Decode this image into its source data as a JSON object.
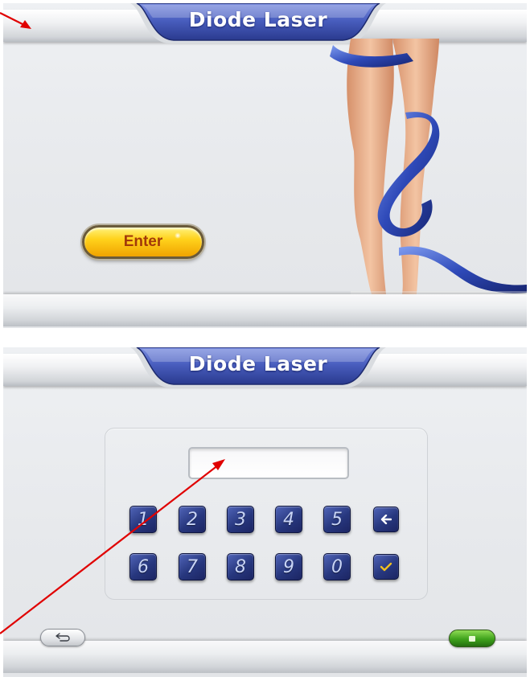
{
  "screen1": {
    "title": "Diode Laser",
    "enter_label": "Enter"
  },
  "screen2": {
    "title": "Diode Laser",
    "pin_value": "",
    "keys_row1": [
      "1",
      "2",
      "3",
      "4",
      "5"
    ],
    "keys_row2": [
      "6",
      "7",
      "8",
      "9",
      "0"
    ],
    "backspace_icon": "backspace-arrow-icon",
    "confirm_icon": "checkmark-icon",
    "back_icon": "return-arrow-icon",
    "save_icon": "save-icon"
  },
  "colors": {
    "title_tab": "#3a4fa8",
    "enter_button": "#ffd21c",
    "enter_text": "#a23a0a",
    "key": "#27377e",
    "save_button": "#3ea21c",
    "annotation_arrow": "#e00000"
  }
}
